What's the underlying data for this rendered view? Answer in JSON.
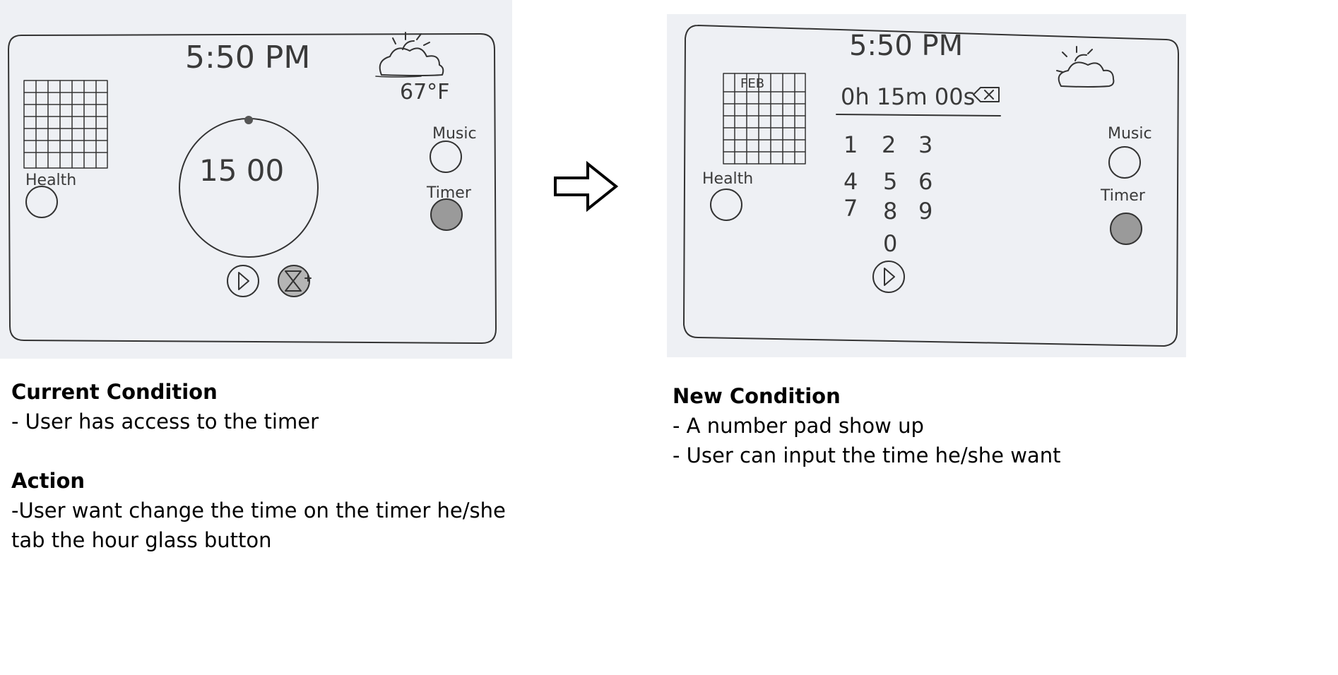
{
  "current": {
    "clock": "5:50 PM",
    "temperature": "67°F",
    "health_label": "Health",
    "music_label": "Music",
    "timer_label": "Timer",
    "timer_value": "15 00"
  },
  "new": {
    "clock": "5:50 PM",
    "calendar_month": "FEB",
    "timer_input": "0h 15m 00s",
    "keypad": [
      "1",
      "2",
      "3",
      "4",
      "5",
      "6",
      "7",
      "8",
      "9",
      "0"
    ],
    "health_label": "Health",
    "music_label": "Music",
    "timer_label": "Timer"
  },
  "notes": {
    "current_heading": "Current Condition",
    "current_line1": "- User has access to the timer",
    "action_heading": "Action",
    "action_line1": "-User want change the time on the timer he/she",
    "action_line2": "tab the hour glass button",
    "new_heading": "New Condition",
    "new_line1": "- A number pad show up",
    "new_line2": "- User can input the time he/she want"
  }
}
